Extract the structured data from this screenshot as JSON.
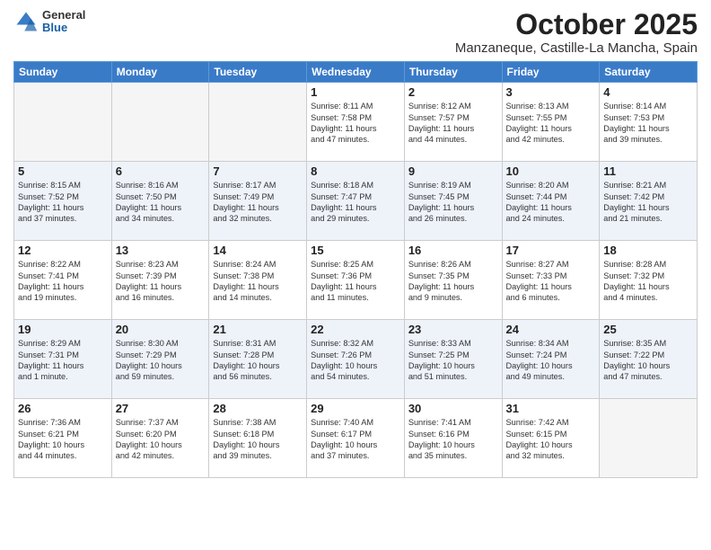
{
  "header": {
    "logo_general": "General",
    "logo_blue": "Blue",
    "month": "October 2025",
    "location": "Manzaneque, Castille-La Mancha, Spain"
  },
  "weekdays": [
    "Sunday",
    "Monday",
    "Tuesday",
    "Wednesday",
    "Thursday",
    "Friday",
    "Saturday"
  ],
  "weeks": [
    [
      {
        "day": "",
        "info": ""
      },
      {
        "day": "",
        "info": ""
      },
      {
        "day": "",
        "info": ""
      },
      {
        "day": "1",
        "info": "Sunrise: 8:11 AM\nSunset: 7:58 PM\nDaylight: 11 hours\nand 47 minutes."
      },
      {
        "day": "2",
        "info": "Sunrise: 8:12 AM\nSunset: 7:57 PM\nDaylight: 11 hours\nand 44 minutes."
      },
      {
        "day": "3",
        "info": "Sunrise: 8:13 AM\nSunset: 7:55 PM\nDaylight: 11 hours\nand 42 minutes."
      },
      {
        "day": "4",
        "info": "Sunrise: 8:14 AM\nSunset: 7:53 PM\nDaylight: 11 hours\nand 39 minutes."
      }
    ],
    [
      {
        "day": "5",
        "info": "Sunrise: 8:15 AM\nSunset: 7:52 PM\nDaylight: 11 hours\nand 37 minutes."
      },
      {
        "day": "6",
        "info": "Sunrise: 8:16 AM\nSunset: 7:50 PM\nDaylight: 11 hours\nand 34 minutes."
      },
      {
        "day": "7",
        "info": "Sunrise: 8:17 AM\nSunset: 7:49 PM\nDaylight: 11 hours\nand 32 minutes."
      },
      {
        "day": "8",
        "info": "Sunrise: 8:18 AM\nSunset: 7:47 PM\nDaylight: 11 hours\nand 29 minutes."
      },
      {
        "day": "9",
        "info": "Sunrise: 8:19 AM\nSunset: 7:45 PM\nDaylight: 11 hours\nand 26 minutes."
      },
      {
        "day": "10",
        "info": "Sunrise: 8:20 AM\nSunset: 7:44 PM\nDaylight: 11 hours\nand 24 minutes."
      },
      {
        "day": "11",
        "info": "Sunrise: 8:21 AM\nSunset: 7:42 PM\nDaylight: 11 hours\nand 21 minutes."
      }
    ],
    [
      {
        "day": "12",
        "info": "Sunrise: 8:22 AM\nSunset: 7:41 PM\nDaylight: 11 hours\nand 19 minutes."
      },
      {
        "day": "13",
        "info": "Sunrise: 8:23 AM\nSunset: 7:39 PM\nDaylight: 11 hours\nand 16 minutes."
      },
      {
        "day": "14",
        "info": "Sunrise: 8:24 AM\nSunset: 7:38 PM\nDaylight: 11 hours\nand 14 minutes."
      },
      {
        "day": "15",
        "info": "Sunrise: 8:25 AM\nSunset: 7:36 PM\nDaylight: 11 hours\nand 11 minutes."
      },
      {
        "day": "16",
        "info": "Sunrise: 8:26 AM\nSunset: 7:35 PM\nDaylight: 11 hours\nand 9 minutes."
      },
      {
        "day": "17",
        "info": "Sunrise: 8:27 AM\nSunset: 7:33 PM\nDaylight: 11 hours\nand 6 minutes."
      },
      {
        "day": "18",
        "info": "Sunrise: 8:28 AM\nSunset: 7:32 PM\nDaylight: 11 hours\nand 4 minutes."
      }
    ],
    [
      {
        "day": "19",
        "info": "Sunrise: 8:29 AM\nSunset: 7:31 PM\nDaylight: 11 hours\nand 1 minute."
      },
      {
        "day": "20",
        "info": "Sunrise: 8:30 AM\nSunset: 7:29 PM\nDaylight: 10 hours\nand 59 minutes."
      },
      {
        "day": "21",
        "info": "Sunrise: 8:31 AM\nSunset: 7:28 PM\nDaylight: 10 hours\nand 56 minutes."
      },
      {
        "day": "22",
        "info": "Sunrise: 8:32 AM\nSunset: 7:26 PM\nDaylight: 10 hours\nand 54 minutes."
      },
      {
        "day": "23",
        "info": "Sunrise: 8:33 AM\nSunset: 7:25 PM\nDaylight: 10 hours\nand 51 minutes."
      },
      {
        "day": "24",
        "info": "Sunrise: 8:34 AM\nSunset: 7:24 PM\nDaylight: 10 hours\nand 49 minutes."
      },
      {
        "day": "25",
        "info": "Sunrise: 8:35 AM\nSunset: 7:22 PM\nDaylight: 10 hours\nand 47 minutes."
      }
    ],
    [
      {
        "day": "26",
        "info": "Sunrise: 7:36 AM\nSunset: 6:21 PM\nDaylight: 10 hours\nand 44 minutes."
      },
      {
        "day": "27",
        "info": "Sunrise: 7:37 AM\nSunset: 6:20 PM\nDaylight: 10 hours\nand 42 minutes."
      },
      {
        "day": "28",
        "info": "Sunrise: 7:38 AM\nSunset: 6:18 PM\nDaylight: 10 hours\nand 39 minutes."
      },
      {
        "day": "29",
        "info": "Sunrise: 7:40 AM\nSunset: 6:17 PM\nDaylight: 10 hours\nand 37 minutes."
      },
      {
        "day": "30",
        "info": "Sunrise: 7:41 AM\nSunset: 6:16 PM\nDaylight: 10 hours\nand 35 minutes."
      },
      {
        "day": "31",
        "info": "Sunrise: 7:42 AM\nSunset: 6:15 PM\nDaylight: 10 hours\nand 32 minutes."
      },
      {
        "day": "",
        "info": ""
      }
    ]
  ]
}
